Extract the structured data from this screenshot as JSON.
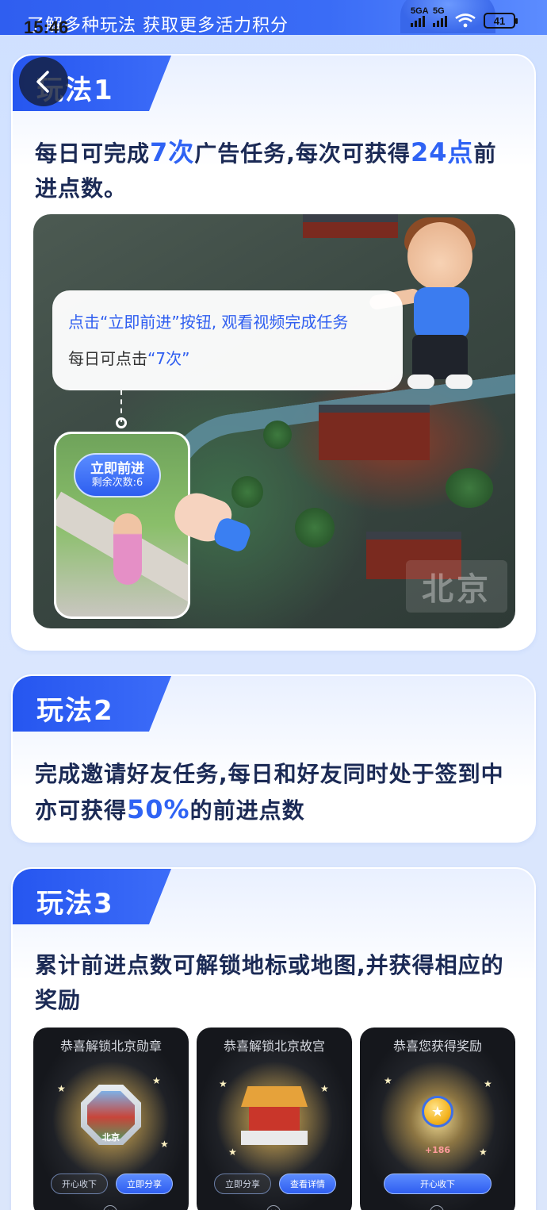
{
  "status_bar": {
    "time": "15:46",
    "net1": "5GA",
    "net2": "5G",
    "battery": "41"
  },
  "banner": {
    "text": "了解多种玩法 获取更多活力积分"
  },
  "icons": {
    "back": "back-chevron-icon",
    "wifi": "wifi-icon",
    "battery": "battery-icon",
    "signal": "signal-icon",
    "close": "close-icon",
    "coin": "star-coin-icon"
  },
  "colors": {
    "accent": "#2f5ef0",
    "highlight": "#2f63f4",
    "text_dark": "#1b2a55"
  },
  "cards": [
    {
      "label": "玩法1",
      "desc_parts": [
        "每日可完成",
        "7次",
        "广告任务,每次可获得",
        "24点",
        "前进点数。"
      ],
      "scene": {
        "speech_line1": "点击“立即前进”按钮, 观看视频完成任务",
        "speech_line2_prefix": "每日可点击",
        "speech_line2_quote": "“7次”",
        "go_button_label": "立即前进",
        "go_button_sub": "剩余次数:6",
        "city_stamp": "北京"
      }
    },
    {
      "label": "玩法2",
      "desc_parts": [
        "完成邀请好友任务,每日和好友同时处于签到中亦可获得",
        "50%",
        "的前进点数"
      ]
    },
    {
      "label": "玩法3",
      "desc_parts": [
        "累计前进点数可解锁地标或地图,并获得相应的奖励"
      ],
      "thumbs": [
        {
          "title": "恭喜解锁北京勋章",
          "badge_city": "北京",
          "btn_left": "开心收下",
          "btn_right": "立即分享"
        },
        {
          "title": "恭喜解锁北京故宫",
          "btn_left": "立即分享",
          "btn_right": "查看详情"
        },
        {
          "title": "恭喜您获得奖励",
          "reward": "+186",
          "btn_main": "开心收下"
        }
      ]
    }
  ]
}
